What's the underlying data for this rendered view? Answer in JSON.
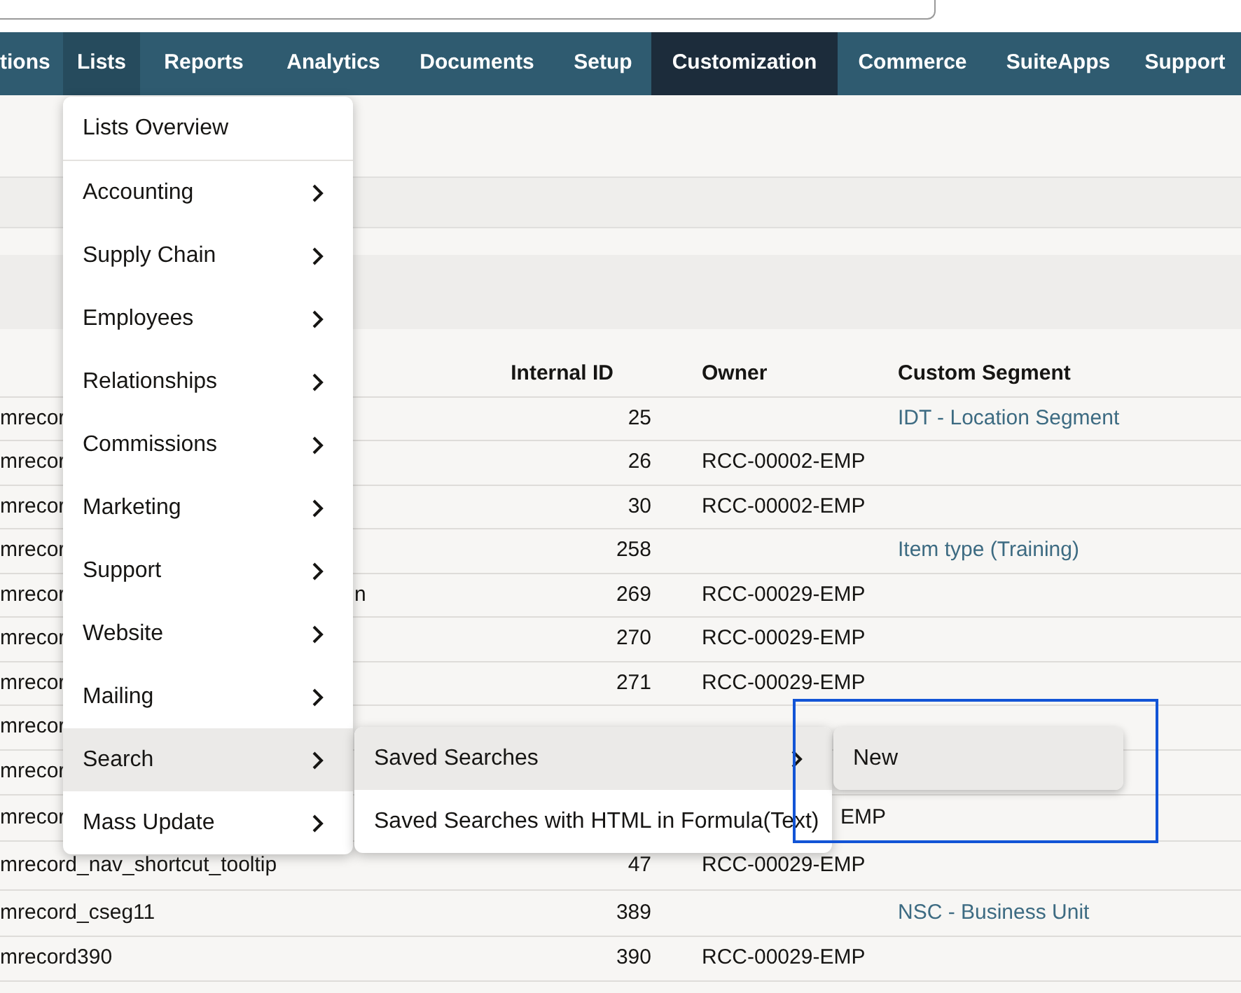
{
  "nav": [
    {
      "label": "tions",
      "open": false,
      "current": false
    },
    {
      "label": "Lists",
      "open": true,
      "current": false
    },
    {
      "label": "Reports",
      "open": false,
      "current": false
    },
    {
      "label": "Analytics",
      "open": false,
      "current": false
    },
    {
      "label": "Documents",
      "open": false,
      "current": false
    },
    {
      "label": "Setup",
      "open": false,
      "current": false
    },
    {
      "label": "Customization",
      "open": false,
      "current": true
    },
    {
      "label": "Commerce",
      "open": false,
      "current": false
    },
    {
      "label": "SuiteApps",
      "open": false,
      "current": false
    },
    {
      "label": "Support",
      "open": false,
      "current": false
    }
  ],
  "table": {
    "columns": [
      "Internal ID",
      "Owner",
      "Custom Segment"
    ],
    "rows": [
      {
        "name": "mrecor",
        "id": "25",
        "owner": "",
        "segment": "IDT - Location Segment"
      },
      {
        "name": "mrecor",
        "id": "26",
        "owner": "RCC-00002-EMP",
        "segment": ""
      },
      {
        "name": "mrecor",
        "id": "30",
        "owner": "RCC-00002-EMP",
        "segment": ""
      },
      {
        "name": "mrecor",
        "id": "258",
        "owner": "",
        "segment": "Item type (Training)"
      },
      {
        "name": "mrecor",
        "name_tail": "n",
        "id": "269",
        "owner": "RCC-00029-EMP",
        "segment": ""
      },
      {
        "name": "mrecor",
        "id": "270",
        "owner": "RCC-00029-EMP",
        "segment": ""
      },
      {
        "name": "mrecor",
        "id": "271",
        "owner": "RCC-00029-EMP",
        "segment": ""
      },
      {
        "name": "mrecor",
        "id": "",
        "owner": "",
        "segment": ""
      },
      {
        "name": "mrecor",
        "id": "",
        "owner": "",
        "segment": ""
      },
      {
        "name": "mrecor",
        "id": "",
        "owner": "EMP",
        "segment": ""
      },
      {
        "name": "mrecord_nav_shortcut_tooltip",
        "id": "47",
        "owner": "RCC-00029-EMP",
        "segment": ""
      },
      {
        "name": "mrecord_cseg11",
        "id": "389",
        "owner": "",
        "segment": "NSC - Business Unit"
      },
      {
        "name": "mrecord390",
        "id": "390",
        "owner": "RCC-00029-EMP",
        "segment": ""
      }
    ]
  },
  "menu": {
    "items": [
      {
        "label": "Lists Overview",
        "has_submenu": false,
        "selected": false
      },
      {
        "label": "Accounting",
        "has_submenu": true,
        "selected": false
      },
      {
        "label": "Supply Chain",
        "has_submenu": true,
        "selected": false
      },
      {
        "label": "Employees",
        "has_submenu": true,
        "selected": false
      },
      {
        "label": "Relationships",
        "has_submenu": true,
        "selected": false
      },
      {
        "label": "Commissions",
        "has_submenu": true,
        "selected": false
      },
      {
        "label": "Marketing",
        "has_submenu": true,
        "selected": false
      },
      {
        "label": "Support",
        "has_submenu": true,
        "selected": false
      },
      {
        "label": "Website",
        "has_submenu": true,
        "selected": false
      },
      {
        "label": "Mailing",
        "has_submenu": true,
        "selected": false
      },
      {
        "label": "Search",
        "has_submenu": true,
        "selected": true
      },
      {
        "label": "Mass Update",
        "has_submenu": true,
        "selected": false
      }
    ]
  },
  "submenu": {
    "items": [
      {
        "label": "Saved Searches",
        "has_submenu": true,
        "selected": true
      },
      {
        "label": "Saved Searches with HTML in Formula(Text)",
        "selected": false
      }
    ]
  },
  "submenu_2": {
    "items": [
      {
        "label": "New",
        "selected": true
      }
    ]
  }
}
